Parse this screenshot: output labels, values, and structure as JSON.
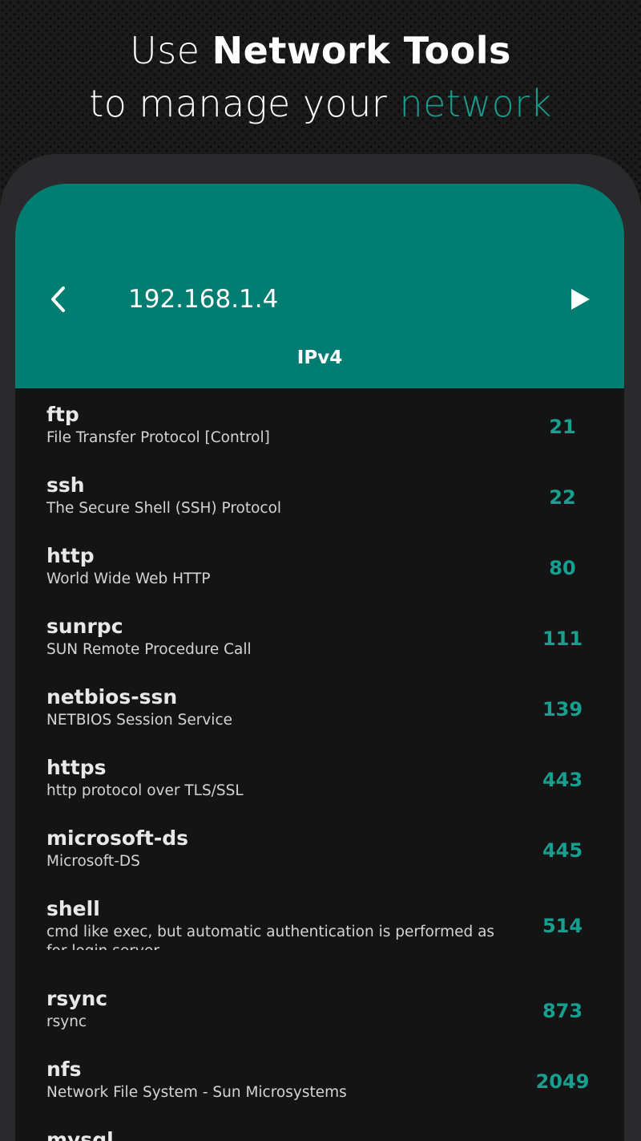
{
  "promo": {
    "line1_prefix": "Use ",
    "line1_bold": "Network Tools",
    "line2_prefix": "to manage your ",
    "line2_accent": "network",
    "accent_color": "#1a9a8c"
  },
  "appbar": {
    "color": "#017e71",
    "back_icon": "chevron-left-icon",
    "title": "192.168.1.4",
    "play_icon": "play-icon",
    "tab": "IPv4"
  },
  "ports": [
    {
      "name": "ftp",
      "description": "File Transfer Protocol [Control]",
      "port": "21"
    },
    {
      "name": "ssh",
      "description": "The Secure Shell (SSH) Protocol",
      "port": "22"
    },
    {
      "name": "http",
      "description": "World Wide Web HTTP",
      "port": "80"
    },
    {
      "name": "sunrpc",
      "description": "SUN Remote Procedure Call",
      "port": "111"
    },
    {
      "name": "netbios-ssn",
      "description": "NETBIOS Session Service",
      "port": "139"
    },
    {
      "name": "https",
      "description": "http protocol over TLS/SSL",
      "port": "443"
    },
    {
      "name": "microsoft-ds",
      "description": "Microsoft-DS",
      "port": "445"
    },
    {
      "name": "shell",
      "description": "cmd like exec, but automatic authentication is performed as for login server",
      "port": "514"
    },
    {
      "name": "rsync",
      "description": "rsync",
      "port": "873"
    },
    {
      "name": "nfs",
      "description": "Network File System - Sun Microsystems",
      "port": "2049"
    },
    {
      "name": "mysql",
      "description": "",
      "port": ""
    }
  ]
}
